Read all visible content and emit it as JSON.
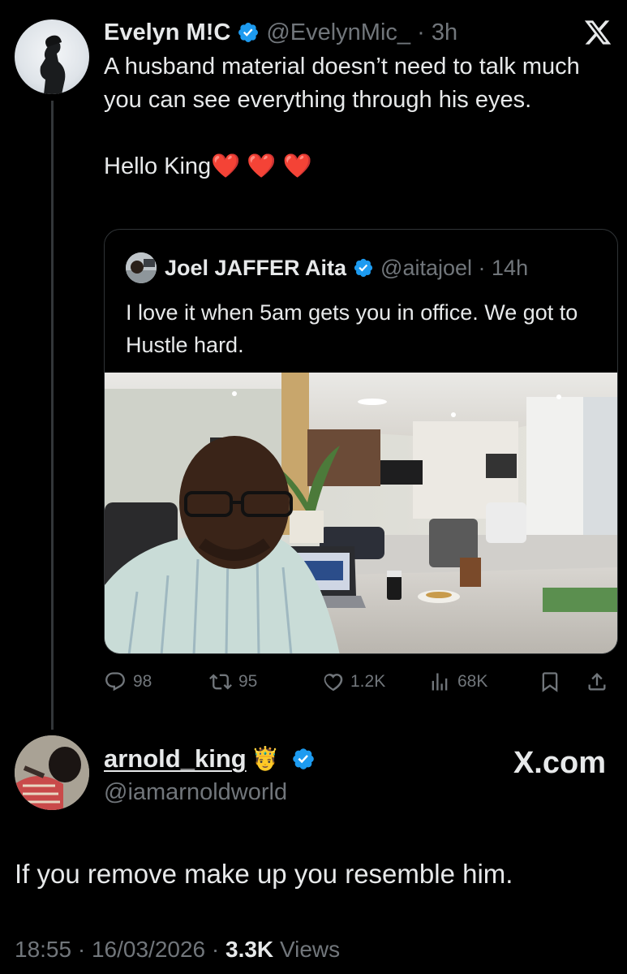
{
  "tweet": {
    "author_name": "Evelyn M!C",
    "author_handle": "@EvelynMic_",
    "time": "3h",
    "text": "A husband material doesn’t need to talk much you can see everything through his eyes.",
    "text2": "Hello King❤️ ❤️ ❤️"
  },
  "quote": {
    "author_name": "Joel JAFFER Aita",
    "author_handle": "@aitajoel",
    "time": "14h",
    "text": "I love it when 5am gets you in office. We got to Hustle hard."
  },
  "actions": {
    "replies": "98",
    "reposts": "95",
    "likes": "1.2K",
    "views": "68K"
  },
  "reply": {
    "author_name": "arnold_king",
    "author_emoji": "🤴",
    "author_handle": "@iamarnoldworld",
    "watermark": "X.com",
    "text": "If you remove make up you resemble him.",
    "time": "18:55",
    "date": "16/03/2026",
    "views_count": "3.3K",
    "views_label": "Views"
  },
  "colors": {
    "background": "#000000",
    "text": "#e7e9ea",
    "muted": "#71767b",
    "verified": "#1d9bf0",
    "heart": "#f91880"
  },
  "icons": [
    "verified-badge-icon",
    "x-logo-icon",
    "reply-icon",
    "repost-icon",
    "like-icon",
    "views-icon",
    "bookmark-icon",
    "share-icon"
  ]
}
